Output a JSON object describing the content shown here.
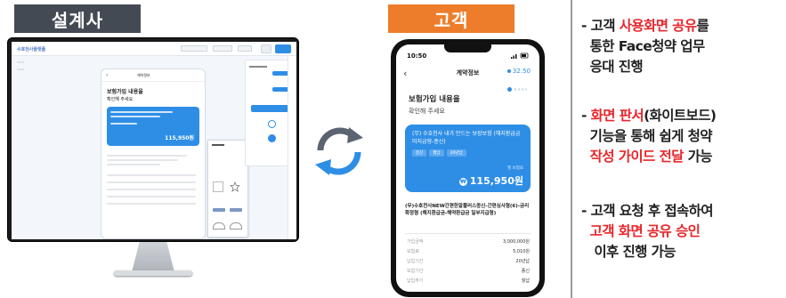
{
  "labels": {
    "designer": "설계사",
    "customer": "고객"
  },
  "colors": {
    "label_bg": "#434a54",
    "customer_label_bg": "#ee7d2b",
    "accent_blue": "#2e8ee6",
    "highlight_red": "#e8262b"
  },
  "phone": {
    "status_time": "10:50",
    "status_icons": "signal-wifi-battery-icons",
    "back_icon": "‹",
    "title": "계약정보",
    "timer": "32:50",
    "heading": "보험가입 내용을",
    "subheading": "확인해 주세요",
    "card": {
      "product_name": "(무) 수호천사 내가 만드는 보장보험 (해지환급금 미지급형-종신)",
      "tags": [
        "종신",
        "월납",
        "20년납"
      ],
      "caption": "월 보험료",
      "amount": "115,950원"
    },
    "description": "(무)수호천사NEW간편한알플러스종신-간편심사형(6)-금리확정형 (해지환급금-해약환급금 일부지급형)",
    "rows": [
      {
        "key": "가입금액",
        "value": "3,000,000원"
      },
      {
        "key": "보험료",
        "value": "5,010원"
      },
      {
        "key": "납입기간",
        "value": "20년납"
      },
      {
        "key": "보험기간",
        "value": "종신"
      },
      {
        "key": "납입주기",
        "value": "월납"
      }
    ]
  },
  "monitor": {
    "app_logo": "수호천사플랫폼",
    "mini_title": "계약정보",
    "mini_heading_1": "보험가입 내용을",
    "mini_heading_2": "확인해 주세요",
    "mini_amount": "115,950원"
  },
  "info": {
    "items": [
      {
        "lines": [
          [
            {
              "t": "- 고객 ",
              "c": "dark"
            },
            {
              "t": "사용화면 공유",
              "c": "red"
            },
            {
              "t": "를",
              "c": "dark"
            }
          ],
          [
            {
              "t": "  통한 Face청약 업무",
              "c": "dark"
            }
          ],
          [
            {
              "t": "  응대 진행",
              "c": "dark"
            }
          ]
        ]
      },
      {
        "lines": [
          [
            {
              "t": "- ",
              "c": "dark"
            },
            {
              "t": "화면 판서",
              "c": "red"
            },
            {
              "t": "(화이트보드)",
              "c": "dark"
            }
          ],
          [
            {
              "t": "  기능을 통해 쉽게 청약",
              "c": "dark"
            }
          ],
          [
            {
              "t": "  작성 가이드 전달",
              "c": "red"
            },
            {
              "t": " 가능",
              "c": "dark"
            }
          ]
        ]
      },
      {
        "lines": [
          [
            {
              "t": "- 고객 요청 후 접속하여",
              "c": "dark"
            }
          ],
          [
            {
              "t": "  고객 화면 공유 승인",
              "c": "red"
            }
          ],
          [
            {
              "t": "   이후 진행 가능",
              "c": "dark"
            }
          ]
        ]
      }
    ]
  }
}
